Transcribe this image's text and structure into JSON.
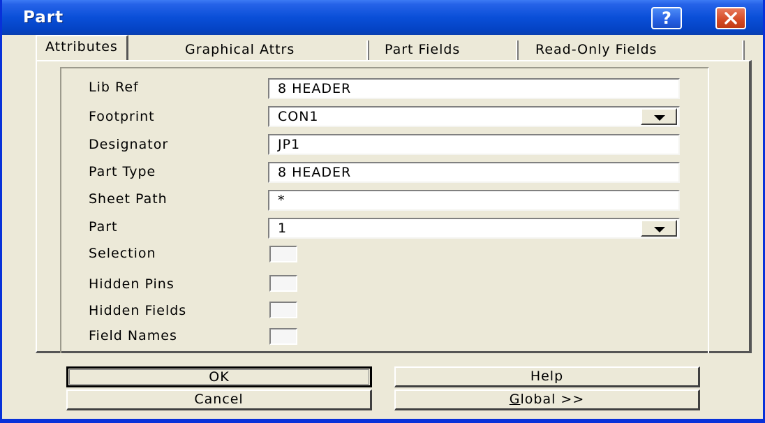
{
  "window": {
    "title": "Part",
    "help_glyph": "?"
  },
  "tabs": [
    {
      "label": "Attributes",
      "active": true
    },
    {
      "label": "Graphical Attrs",
      "active": false
    },
    {
      "label": "Part Fields",
      "active": false
    },
    {
      "label": "Read-Only Fields",
      "active": false
    }
  ],
  "fields": {
    "lib_ref": {
      "label": "Lib Ref",
      "value": "8 HEADER"
    },
    "footprint": {
      "label": "Footprint",
      "value": "CON1"
    },
    "designator": {
      "label": "Designator",
      "value": "JP1"
    },
    "part_type": {
      "label": "Part Type",
      "value": "8 HEADER"
    },
    "sheet_path": {
      "label": "Sheet Path",
      "value": "*"
    },
    "part": {
      "label": "Part",
      "value": "1"
    }
  },
  "checkboxes": {
    "selection": {
      "label": "Selection",
      "checked": false
    },
    "hidden_pins": {
      "label": "Hidden Pins",
      "checked": false
    },
    "hidden_fields": {
      "label": "Hidden Fields",
      "checked": false
    },
    "field_names": {
      "label": "Field Names",
      "checked": false
    }
  },
  "buttons": {
    "ok": "OK",
    "help": "Help",
    "cancel": "Cancel",
    "global_mnemonic": "G",
    "global_rest": "lobal >>"
  },
  "icons": {
    "help": "question-icon",
    "close": "close-x-icon",
    "dropdown": "triangle-down-icon"
  },
  "colors": {
    "titlebar": "#0a4fd8",
    "close_button": "#d44a25",
    "dialog_face": "#ece9d8"
  }
}
